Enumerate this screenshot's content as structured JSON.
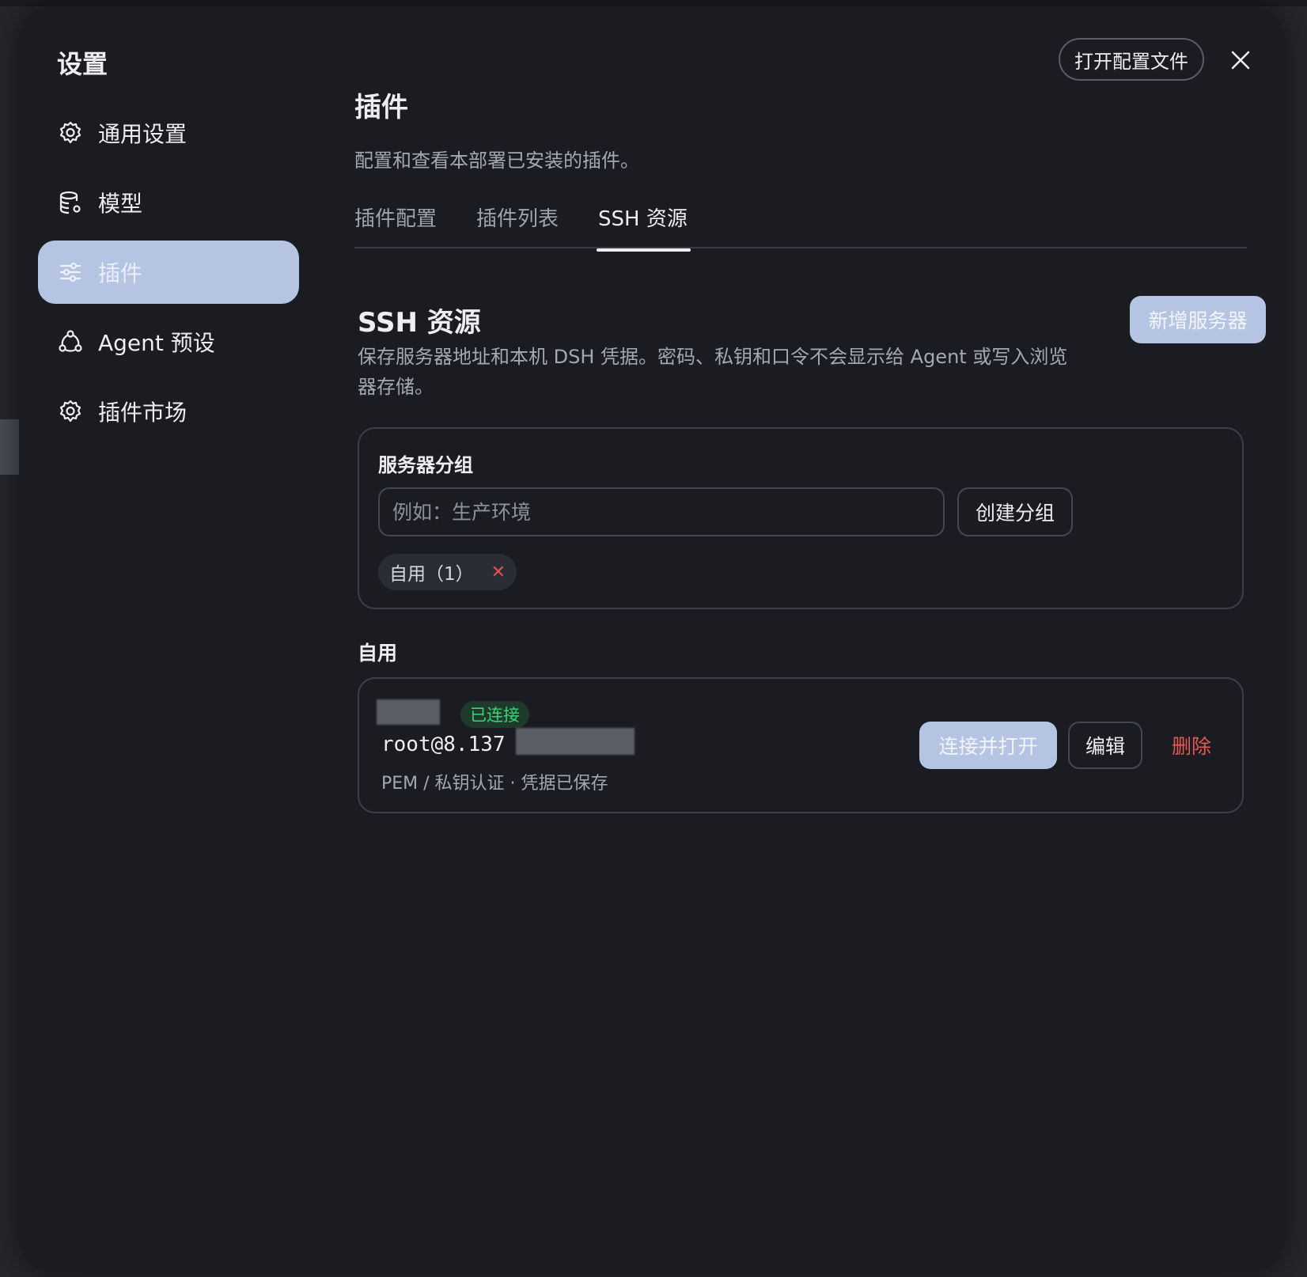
{
  "window": {
    "title": "设置",
    "open_config_label": "打开配置文件"
  },
  "sidebar": {
    "items": [
      {
        "label": "通用设置",
        "icon": "gear-icon",
        "active": false
      },
      {
        "label": "模型",
        "icon": "database-gear-icon",
        "active": false
      },
      {
        "label": "插件",
        "icon": "sliders-icon",
        "active": true
      },
      {
        "label": "Agent 预设",
        "icon": "agent-icon",
        "active": false
      },
      {
        "label": "插件市场",
        "icon": "gear-icon",
        "active": false
      }
    ]
  },
  "main": {
    "title": "插件",
    "description": "配置和查看本部署已安装的插件。",
    "tabs": [
      {
        "label": "插件配置",
        "active": false
      },
      {
        "label": "插件列表",
        "active": false
      },
      {
        "label": "SSH 资源",
        "active": true
      }
    ]
  },
  "ssh": {
    "title": "SSH 资源",
    "description": "保存服务器地址和本机 DSH 凭据。密码、私钥和口令不会显示给 Agent 或写入浏览器存储。",
    "add_server_label": "新增服务器",
    "groups_card": {
      "label": "服务器分组",
      "input_placeholder": "例如：生产环境",
      "input_value": "",
      "create_label": "创建分组",
      "chips": [
        {
          "label": "自用（1）"
        }
      ]
    },
    "group_heading": "自用",
    "server": {
      "status": "已连接",
      "host": "root@8.137",
      "auth": "PEM / 私钥认证 · 凭据已保存",
      "connect_label": "连接并打开",
      "edit_label": "编辑",
      "delete_label": "删除"
    }
  },
  "colors": {
    "accent": "#b6c4e4",
    "success": "#3ed178",
    "danger": "#e35a55",
    "background": "#1a1c21"
  }
}
